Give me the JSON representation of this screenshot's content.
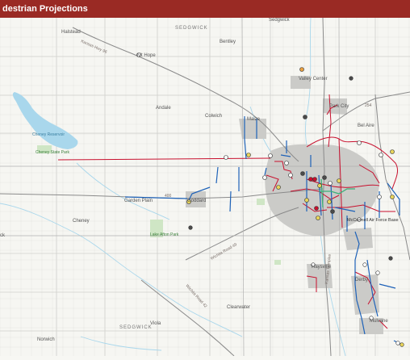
{
  "header": {
    "title": "destrian Projections"
  },
  "colors": {
    "header_bg": "#9a2a24",
    "urban": "#c9c9c6",
    "water": "#a9d7ec",
    "park": "#cfe6c5",
    "bike_network_blue": "#1e62b8",
    "project_red": "#c8102e",
    "highway": "#8a8a8a",
    "dot_yellow": "#e9d55a",
    "dot_dark": "#4a4a4a"
  },
  "map": {
    "counties": [
      "SEDGWICK",
      "SEDGWICK"
    ],
    "places": [
      "Sedgwick",
      "Bentley",
      "Halstead",
      "Mt Hope",
      "Valley Center",
      "Park City",
      "Andale",
      "Colwich",
      "Maize",
      "Bel Aire",
      "Garden Plain",
      "Goddard",
      "Cheney",
      "McConnell Air Force Base",
      "Haysville",
      "Derby",
      "Clearwater",
      "Viola",
      "Mulvane",
      "Norwich",
      "ck"
    ],
    "water": [
      "Cheney Reservoir"
    ],
    "parks": [
      "Cheney State Park",
      "Lake Afton Park"
    ],
    "roads": [
      "Kansas Hwy 96",
      "Kansas Turnpike",
      "254",
      "400",
      "Wichita Road 42",
      "Wichita Road 49"
    ]
  }
}
